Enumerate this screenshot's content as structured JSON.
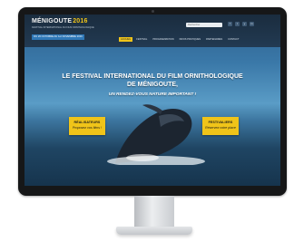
{
  "site": {
    "logo_main": "MÉNIGOUTE",
    "logo_year": "2016",
    "tagline": "FESTIVAL INTERNATIONAL DU FILM ORNITHOLOGIQUE",
    "date_bar": "DU 26 OCTOBRE AU 1er NOVEMBRE 2016",
    "search_placeholder": "Rechercher",
    "social": [
      "f",
      "t",
      "y",
      "in"
    ]
  },
  "nav": {
    "items": [
      {
        "label": "ACCUEIL",
        "active": true
      },
      {
        "label": "FESTIVAL",
        "active": false
      },
      {
        "label": "PROGRAMMATION",
        "active": false
      },
      {
        "label": "INFOS PRATIQUES",
        "active": false
      },
      {
        "label": "PARTENAIRES",
        "active": false
      },
      {
        "label": "CONTACT",
        "active": false
      }
    ]
  },
  "hero": {
    "title": "LE FESTIVAL INTERNATIONAL DU FILM ORNITHOLOGIQUE DE MÉNIGOUTE,",
    "subtitle": "UN RENDEZ-VOUS NATURE IMPORTANT !"
  },
  "cta_left": {
    "line1": "RÉALISATEURS",
    "line2": "Proposez vos films !"
  },
  "cta_right": {
    "line1": "FESTIVALIERS",
    "line2": "Réservez votre place"
  },
  "colors": {
    "accent": "#f0c419",
    "header": "#1a2c3e",
    "sea": "#1f4563"
  }
}
